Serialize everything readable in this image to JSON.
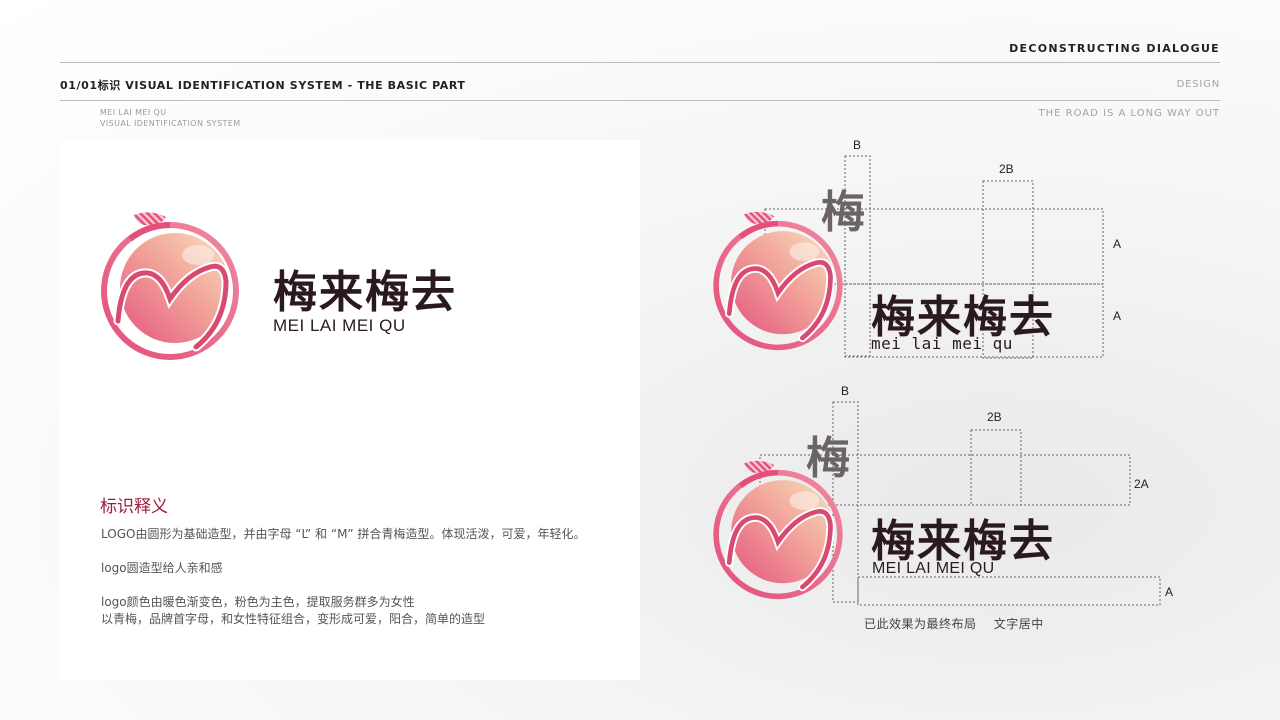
{
  "header": {
    "brand": "DECONSTRUCTING DIALOGUE",
    "section": "01/01标识  VISUAL IDENTIFICATION SYSTEM - THE BASIC PART",
    "design": "DESIGN",
    "road": "THE ROAD IS A LONG WAY OUT",
    "sub_line1": "MEI LAI MEI QU",
    "sub_line2": "VISUAL IDENTIFICATION SYSTEM"
  },
  "logo": {
    "cn": "梅来梅去",
    "en": "MEI LAI MEI QU",
    "en_lower": "mei lai mei qu",
    "single_char": "梅",
    "colors": {
      "pink": "#e0527e",
      "peach": "#f6d2ad",
      "dark": "#2a1a1e"
    }
  },
  "meaning": {
    "title": "标识释义",
    "p1": "LOGO由圆形为基础造型，并由字母 “L” 和 “M” 拼合青梅造型。体现活泼，可爱，年轻化。",
    "p2": "logo圆造型给人亲和感",
    "p3_line1": "logo颜色由暖色渐变色，粉色为主色，提取服务群多为女性",
    "p3_line2": "以青梅，品牌首字母，和女性特征组合，变形成可爱，阳合，简单的造型"
  },
  "diagram": {
    "label_b": "B",
    "label_2b": "2B",
    "label_a": "A",
    "label_2a": "2A",
    "caption": "已此效果为最终布局    文字居中"
  }
}
